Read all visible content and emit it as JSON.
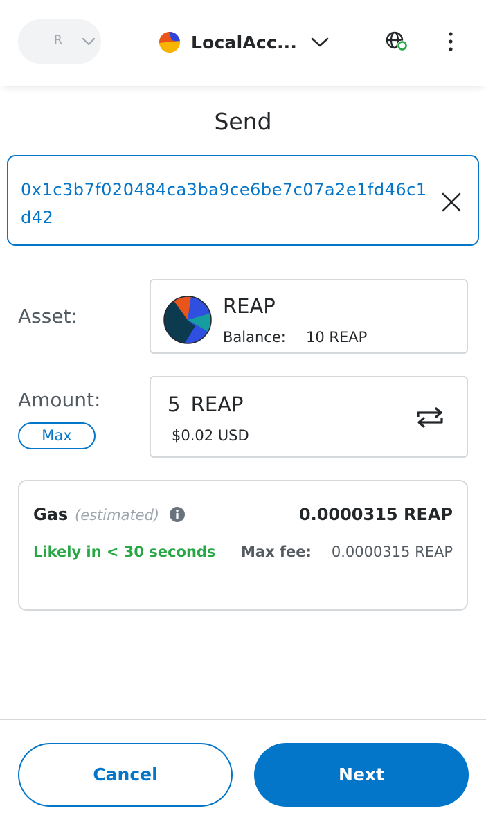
{
  "header": {
    "network_letter": "R",
    "account_name": "LocalAcc...",
    "icons": {
      "network_chevron": "chevron-down-icon",
      "account_avatar": "account-avatar-icon",
      "account_chevron": "chevron-down-icon",
      "connected_sites": "globe-connected-icon",
      "menu": "kebab-menu-icon"
    }
  },
  "page": {
    "title": "Send"
  },
  "recipient": {
    "address": "0x1c3b7f020484ca3ba9ce6be7c07a2e1fd46c1d42"
  },
  "asset": {
    "label": "Asset:",
    "symbol": "REAP",
    "balance_label": "Balance:",
    "balance_value": "10 REAP"
  },
  "amount": {
    "label": "Amount:",
    "max_label": "Max",
    "value": "5 REAP",
    "fiat": "$0.02 USD"
  },
  "gas": {
    "title": "Gas",
    "estimated_label": "(estimated)",
    "amount": "0.0000315 REAP",
    "time": "Likely in < 30 seconds",
    "max_fee_label": "Max fee:",
    "max_fee_value": "0.0000315 REAP"
  },
  "footer": {
    "cancel_label": "Cancel",
    "next_label": "Next"
  },
  "colors": {
    "primary": "#0376c9",
    "success": "#28a745",
    "border": "#d6d9dc",
    "text": "#24272a",
    "muted": "#9fa6ae"
  }
}
